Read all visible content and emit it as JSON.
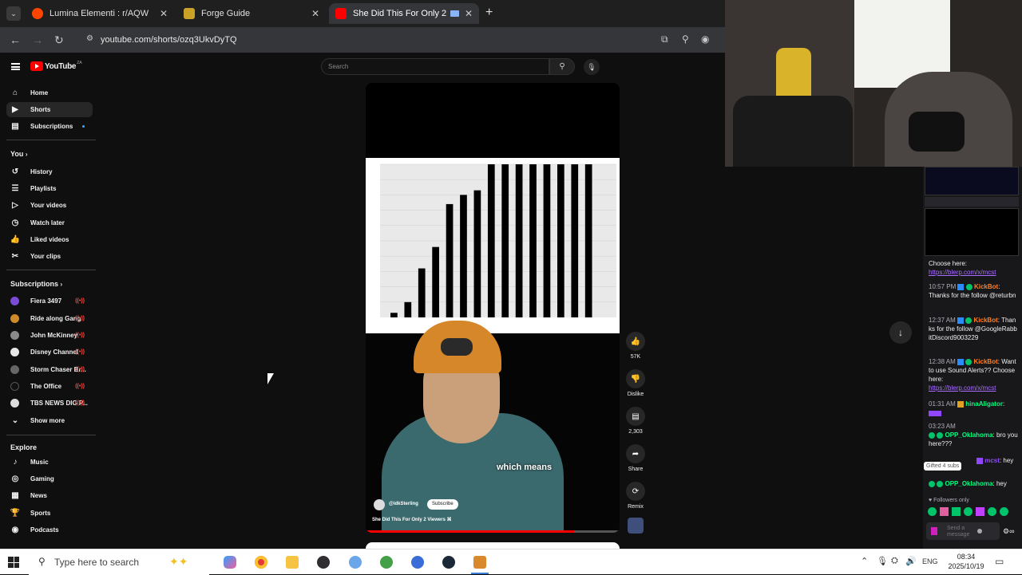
{
  "browser": {
    "tabs": [
      {
        "title": "Lumina Elementi : r/AQW",
        "active": false,
        "color": "#ff4500"
      },
      {
        "title": "Forge Guide",
        "active": false,
        "color": "#c9a227"
      },
      {
        "title": "She Did This For Only 2 Vie",
        "active": true,
        "color": "#ff0000"
      }
    ],
    "close_glyph": "✕",
    "new_tab_glyph": "+",
    "url": "youtube.com/shorts/ozq3UkvDyTQ"
  },
  "youtube": {
    "logo_text": "YouTube",
    "logo_region": "ZA",
    "search_placeholder": "Search",
    "nav_main": [
      {
        "label": "Home",
        "icon": "home-icon"
      },
      {
        "label": "Shorts",
        "icon": "shorts-icon"
      },
      {
        "label": "Subscriptions",
        "icon": "subscriptions-icon"
      }
    ],
    "you_header": "You",
    "nav_you": [
      {
        "label": "History",
        "icon": "history-icon"
      },
      {
        "label": "Playlists",
        "icon": "playlists-icon"
      },
      {
        "label": "Your videos",
        "icon": "your-videos-icon"
      },
      {
        "label": "Watch later",
        "icon": "watch-later-icon"
      },
      {
        "label": "Liked videos",
        "icon": "liked-videos-icon"
      },
      {
        "label": "Your clips",
        "icon": "clips-icon"
      }
    ],
    "subscriptions_header": "Subscriptions",
    "subscriptions": [
      {
        "label": "Fiera 3497",
        "color": "#7a4bd6"
      },
      {
        "label": "Ride along Gang",
        "color": "#d08a2a"
      },
      {
        "label": "John McKinney",
        "color": "#8a8a8a"
      },
      {
        "label": "Disney Channel",
        "color": "#e8e8e8"
      },
      {
        "label": "Storm Chaser Br...",
        "color": "#666"
      },
      {
        "label": "The Office",
        "color": "#111"
      },
      {
        "label": "TBS NEWS DIG P...",
        "color": "#ddd"
      }
    ],
    "show_more": "Show more",
    "explore_header": "Explore",
    "explore": [
      {
        "label": "Music",
        "icon": "music-icon"
      },
      {
        "label": "Gaming",
        "icon": "gaming-icon"
      },
      {
        "label": "News",
        "icon": "news-icon"
      },
      {
        "label": "Sports",
        "icon": "sports-icon"
      },
      {
        "label": "Podcasts",
        "icon": "podcasts-icon"
      }
    ],
    "video": {
      "caption": "which means",
      "channel": "@idkSterling",
      "subscribe": "Subscribe",
      "title": "She Did This For Only 2 Viewers",
      "progress": 0.82
    },
    "actions": {
      "likes": "57K",
      "dislike": "Dislike",
      "comments": "2,303",
      "share": "Share",
      "remix": "Remix"
    }
  },
  "chart_data": {
    "type": "bar",
    "values": [
      3,
      10,
      32,
      46,
      74,
      80,
      83,
      100,
      100,
      100,
      100,
      100,
      100,
      100,
      100
    ],
    "ylim": [
      0,
      100
    ]
  },
  "chat": {
    "top_text": "Choose here:",
    "top_link": "https://blerp.com/x/mcst",
    "messages": [
      {
        "time": "10:57 PM",
        "nick": "KickBot",
        "text": "Thanks for the follow @returbn",
        "nick_color": "k"
      },
      {
        "time": "12:37 AM",
        "nick": "KickBot",
        "text": "Thanks for the follow @GoogleRabbitDiscord9003229",
        "nick_color": "k"
      },
      {
        "time": "12:38 AM",
        "nick": "KickBot",
        "text": "Want to use Sound Alerts?? Choose here:",
        "link": "https://blerp.com/x/mcst",
        "nick_color": "k"
      },
      {
        "time": "01:31 AM",
        "nick": "hinaAligator",
        "text": "",
        "nick_color": "g"
      },
      {
        "time": "03:23 AM",
        "nick": "OPP_Oklahoma",
        "text": "bro you here???",
        "nick_color": "g"
      },
      {
        "time": "",
        "nick": "mcst",
        "text": "hey",
        "nick_color": "p"
      },
      {
        "time": "",
        "nick": "OPP_Oklahoma",
        "text": "hey",
        "nick_color": "g"
      }
    ],
    "gifted_tooltip": "Gifted 4 subs",
    "followers_only": "Followers only",
    "send_placeholder": "Send a message"
  },
  "taskbar": {
    "search_placeholder": "Type here to search",
    "language": "ENG",
    "time": "08:34",
    "date": "2025/10/19"
  }
}
